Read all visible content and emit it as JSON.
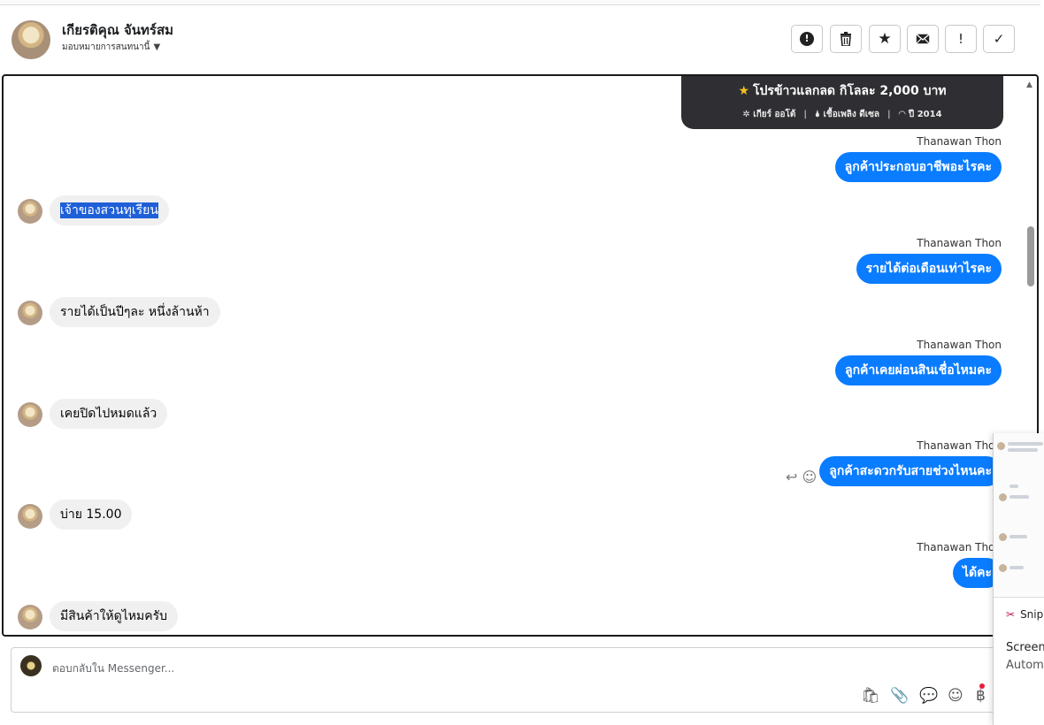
{
  "header": {
    "name": "เกียรติคุณ จันทร์สม",
    "subtitle": "มอบหมายการสนทนานี้",
    "actions": [
      {
        "label": "!",
        "icon": "alert-circle-icon"
      },
      {
        "label": "🗑",
        "icon": "trash-icon"
      },
      {
        "label": "★",
        "icon": "star-icon"
      },
      {
        "label": "✉",
        "icon": "mail-icon"
      },
      {
        "label": "!",
        "icon": "exclamation-icon"
      },
      {
        "label": "✓",
        "icon": "check-icon"
      }
    ]
  },
  "promo": {
    "title": "โปรข้าวแลกลด กิโลละ 2,000 บาท",
    "gear": "เกียร์ ออโต้",
    "fuel": "เชื้อเพลิง ดีเซล",
    "year": "ปี 2014"
  },
  "messages": [
    {
      "sender": "Thanawan Thon",
      "text": "ลูกค้าประกอบอาชีพอะไรคะ"
    },
    {
      "text": "เจ้าของสวนทุเรียน"
    },
    {
      "sender": "Thanawan Thon",
      "text": "รายได้ต่อเดือนเท่าไรคะ"
    },
    {
      "text": "รายได้เป็นปีๆละ หนึ่งล้านห้า"
    },
    {
      "sender": "Thanawan Thon",
      "text": "ลูกค้าเคยผ่อนสินเชื่อไหมคะ"
    },
    {
      "text": "เคยปิดไปหมดแล้ว"
    },
    {
      "sender": "Thanawan Thon",
      "text": "ลูกค้าสะดวกรับสายช่วงไหนคะ"
    },
    {
      "text": "บ่าย 15.00"
    },
    {
      "sender": "Thanawan Thon",
      "text": "ได้คะ"
    },
    {
      "text": "มีสินค้าให้ดูไหมครับ"
    }
  ],
  "composer": {
    "placeholder": "ตอบกลับใน Messenger..."
  },
  "popup": {
    "app": "Snip",
    "line1": "Screens",
    "line2": "Automa"
  }
}
